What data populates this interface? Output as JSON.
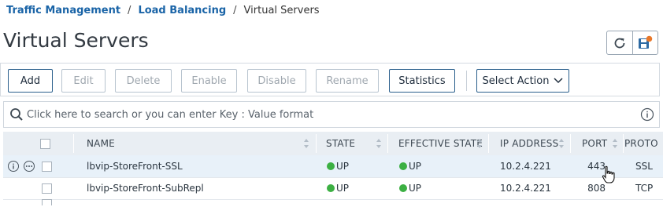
{
  "breadcrumb": {
    "items": [
      "Traffic Management",
      "Load Balancing"
    ],
    "separator": "/",
    "current": "Virtual Servers"
  },
  "page_title": "Virtual Servers",
  "header_icons": [
    "refresh-icon",
    "save-icon"
  ],
  "toolbar": {
    "add": "Add",
    "edit": "Edit",
    "delete": "Delete",
    "enable": "Enable",
    "disable": "Disable",
    "rename": "Rename",
    "statistics": "Statistics",
    "select_action": "Select Action"
  },
  "search": {
    "placeholder": "Click here to search or you can enter Key : Value format"
  },
  "table": {
    "columns": {
      "name": "NAME",
      "state": "STATE",
      "effective_state": "EFFECTIVE STATE",
      "ip_address": "IP ADDRESS",
      "port": "PORT",
      "protocol": "PROTO"
    },
    "rows": [
      {
        "name": "lbvip-StoreFront-SSL",
        "state": "UP",
        "effective_state": "UP",
        "ip_address": "10.2.4.221",
        "port": "443",
        "protocol": "SSL"
      },
      {
        "name": "lbvip-StoreFront-SubRepl",
        "state": "UP",
        "effective_state": "UP",
        "ip_address": "10.2.4.221",
        "port": "808",
        "protocol": "TCP"
      }
    ]
  },
  "colors": {
    "link": "#1a64a7",
    "status_up": "#3cb043",
    "button_border": "#2a5f8c",
    "header_bg": "#e9eef3",
    "selected_row": "#e8f1f9",
    "save_icon_accent": "#e8782a"
  }
}
